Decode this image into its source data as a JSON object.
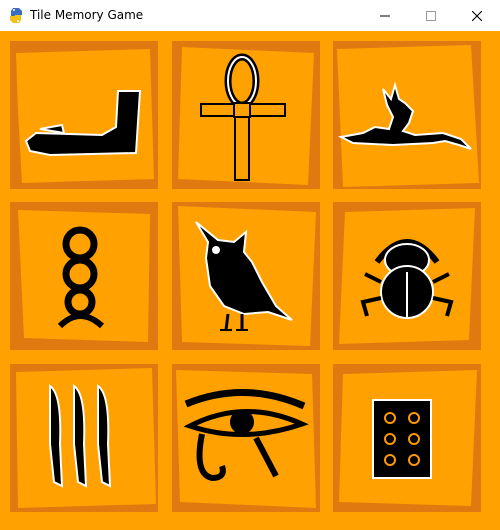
{
  "window": {
    "title": "Tile Memory Game"
  },
  "controls": {
    "minimize": "minimize",
    "maximize": "maximize",
    "close": "close"
  },
  "colors": {
    "background": "#ffa100",
    "tile_dark": "#e07a10",
    "tile_light": "#ffa100",
    "highlight": "#ffee00",
    "glyph": "#000000"
  },
  "board": {
    "rows": 3,
    "cols": 3,
    "selected_index": 3,
    "tiles": [
      {
        "symbol": "bent-arm-hieroglyph"
      },
      {
        "symbol": "ankh"
      },
      {
        "symbol": "anubis-jackal"
      },
      {
        "symbol": "stacked-rings-hieroglyph"
      },
      {
        "symbol": "owl"
      },
      {
        "symbol": "scarab-beetle"
      },
      {
        "symbol": "three-reeds"
      },
      {
        "symbol": "eye-of-horus"
      },
      {
        "symbol": "game-board-dots"
      }
    ]
  }
}
